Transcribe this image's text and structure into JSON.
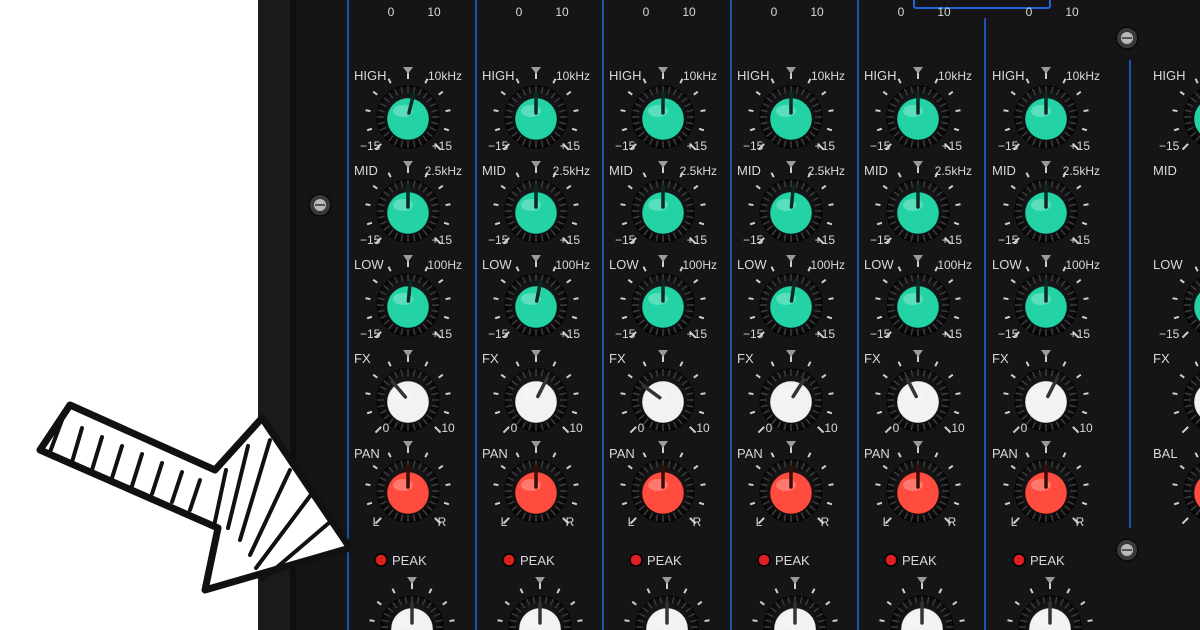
{
  "mixer": {
    "colors": {
      "panel": "#151517",
      "divider": "#1f63d6",
      "knob_eq": "#23d3a6",
      "knob_fx": "#f2f2f2",
      "knob_pan": "#ff4c3e",
      "peak_led": "#e02020",
      "label": "#d9d9d9"
    },
    "top_scale": {
      "min": "0",
      "max": "10"
    },
    "channels": [
      {
        "high_label": "HIGH",
        "high_freq": "10kHz",
        "mid_label": "MID",
        "mid_freq": "2.5kHz",
        "low_label": "LOW",
        "low_freq": "100Hz",
        "eq_min": "−15",
        "eq_max": "+15",
        "fx_label": "FX",
        "fx_min": "0",
        "fx_max": "10",
        "pan_label": "PAN",
        "pan_left": "L",
        "pan_right": "R",
        "peak_label": "PEAK",
        "levels": {
          "high": 0.55,
          "mid": 0.5,
          "low": 0.52,
          "fx": 0.35,
          "pan": 0.5
        }
      },
      {
        "high_label": "HIGH",
        "high_freq": "10kHz",
        "mid_label": "MID",
        "mid_freq": "2.5kHz",
        "low_label": "LOW",
        "low_freq": "100Hz",
        "eq_min": "−15",
        "eq_max": "+15",
        "fx_label": "FX",
        "fx_min": "0",
        "fx_max": "10",
        "pan_label": "PAN",
        "pan_left": "L",
        "pan_right": "R",
        "peak_label": "PEAK",
        "levels": {
          "high": 0.5,
          "mid": 0.5,
          "low": 0.54,
          "fx": 0.6,
          "pan": 0.5
        }
      },
      {
        "high_label": "HIGH",
        "high_freq": "10kHz",
        "mid_label": "MID",
        "mid_freq": "2.5kHz",
        "low_label": "LOW",
        "low_freq": "100Hz",
        "eq_min": "−15",
        "eq_max": "+15",
        "fx_label": "FX",
        "fx_min": "0",
        "fx_max": "10",
        "pan_label": "PAN",
        "pan_left": "L",
        "pan_right": "R",
        "peak_label": "PEAK",
        "levels": {
          "high": 0.5,
          "mid": 0.5,
          "low": 0.5,
          "fx": 0.3,
          "pan": 0.5
        }
      },
      {
        "high_label": "HIGH",
        "high_freq": "10kHz",
        "mid_label": "MID",
        "mid_freq": "2.5kHz",
        "low_label": "LOW",
        "low_freq": "100Hz",
        "eq_min": "−15",
        "eq_max": "+15",
        "fx_label": "FX",
        "fx_min": "0",
        "fx_max": "10",
        "pan_label": "PAN",
        "pan_left": "L",
        "pan_right": "R",
        "peak_label": "PEAK",
        "levels": {
          "high": 0.5,
          "mid": 0.52,
          "low": 0.53,
          "fx": 0.62,
          "pan": 0.5
        }
      },
      {
        "high_label": "HIGH",
        "high_freq": "10kHz",
        "mid_label": "MID",
        "mid_freq": "2.5kHz",
        "low_label": "LOW",
        "low_freq": "100Hz",
        "eq_min": "−15",
        "eq_max": "+15",
        "fx_label": "FX",
        "fx_min": "0",
        "fx_max": "10",
        "pan_label": "PAN",
        "pan_left": "L",
        "pan_right": "R",
        "peak_label": "PEAK",
        "levels": {
          "high": 0.5,
          "mid": 0.5,
          "low": 0.5,
          "fx": 0.4,
          "pan": 0.5
        }
      },
      {
        "high_label": "HIGH",
        "high_freq": "10kHz",
        "mid_label": "MID",
        "mid_freq": "2.5kHz",
        "low_label": "LOW",
        "low_freq": "100Hz",
        "eq_min": "−15",
        "eq_max": "+15",
        "fx_label": "FX",
        "fx_min": "0",
        "fx_max": "10",
        "pan_label": "PAN",
        "pan_left": "L",
        "pan_right": "R",
        "peak_label": "PEAK",
        "levels": {
          "high": 0.5,
          "mid": 0.5,
          "low": 0.5,
          "fx": 0.6,
          "pan": 0.5
        }
      }
    ],
    "partial_channel": {
      "high_label": "HIGH",
      "mid_label": "MID",
      "low_label": "LOW",
      "fx_label": "FX",
      "bal_label": "BAL",
      "eq_min": "−15"
    }
  },
  "annotation": {
    "arrow_icon": "hand-drawn-arrow-icon"
  }
}
